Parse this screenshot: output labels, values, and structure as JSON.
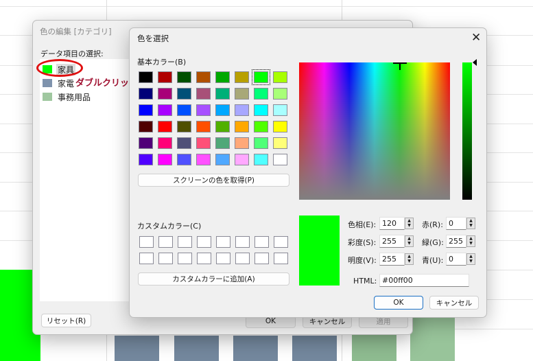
{
  "background_chart": {
    "colors": {
      "furniture": "#00ff00",
      "appliance": "#7a8ca0",
      "office": "#98c49a"
    }
  },
  "edit_dialog": {
    "title": "色の編集 [カテゴリ]",
    "list_label": "データ項目の選択:",
    "items": [
      {
        "label": "家具",
        "color": "#00ff00"
      },
      {
        "label": "家電",
        "color": "#7f93ad"
      },
      {
        "label": "事務用品",
        "color": "#a0c8a0"
      }
    ],
    "annotation": "ダブルクリック",
    "reset_label": "リセット(R)",
    "ok_label": "OK",
    "cancel_label": "キャンセル",
    "apply_label": "適用"
  },
  "color_dialog": {
    "title": "色を選択",
    "close_icon": "close-icon",
    "basic_colors_label": "基本カラー(B)",
    "basic_colors": [
      "#000000",
      "#b00000",
      "#005000",
      "#b05000",
      "#00a800",
      "#b8a000",
      "#00ff00",
      "#a8ff00",
      "#000078",
      "#a80078",
      "#005078",
      "#a85078",
      "#00b078",
      "#a8a878",
      "#00ff78",
      "#a8ff78",
      "#0000ff",
      "#a800ff",
      "#0050ff",
      "#a850ff",
      "#00a8ff",
      "#a8a8ff",
      "#00ffff",
      "#a8ffff",
      "#500000",
      "#ff0000",
      "#505000",
      "#ff5000",
      "#50b000",
      "#ffa800",
      "#50ff00",
      "#ffff00",
      "#500078",
      "#ff0078",
      "#505078",
      "#ff5078",
      "#50a878",
      "#ffa878",
      "#50ff78",
      "#ffff78",
      "#5000ff",
      "#ff00ff",
      "#5050ff",
      "#ff50ff",
      "#50a8ff",
      "#ffa8ff",
      "#50ffff",
      "#ffffff"
    ],
    "selected_index": 6,
    "pick_screen_label": "スクリーンの色を取得(P)",
    "custom_colors_label": "カスタムカラー(C)",
    "add_custom_label": "カスタムカラーに追加(A)",
    "preview_color": "#00ff00",
    "hue_label": "色相(E):",
    "hue": "120",
    "sat_label": "彩度(S):",
    "sat": "255",
    "val_label": "明度(V):",
    "val": "255",
    "red_label": "赤(R):",
    "red": "0",
    "green_label": "緑(G):",
    "green": "255",
    "blue_label": "青(U):",
    "blue": "0",
    "html_label": "HTML:",
    "html": "#00ff00",
    "ok_label": "OK",
    "cancel_label": "キャンセル"
  }
}
